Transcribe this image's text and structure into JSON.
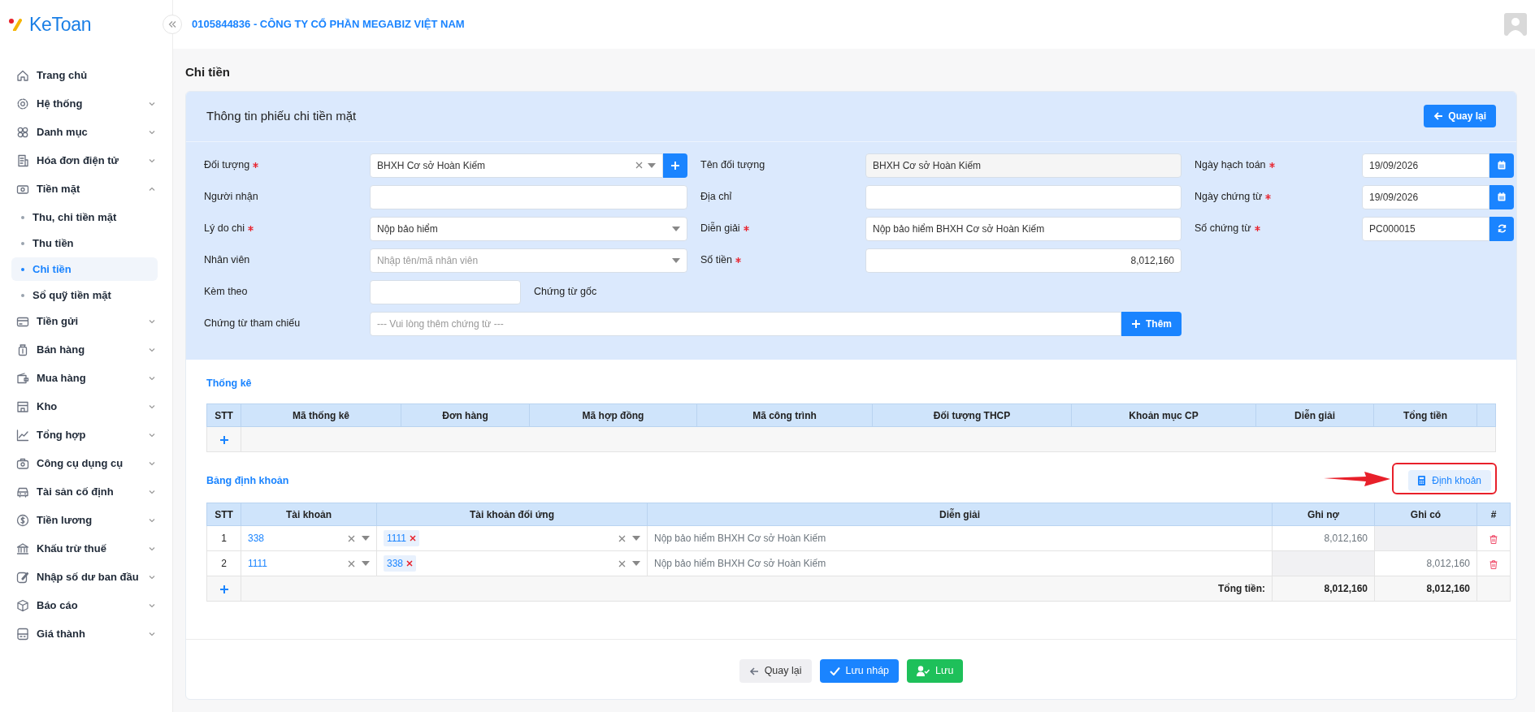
{
  "brand": {
    "name": "KeToan"
  },
  "header": {
    "company": "0105844836 - CÔNG TY CỔ PHẦN MEGABIZ VIỆT NAM"
  },
  "sidebar": {
    "items": [
      {
        "label": "Trang chủ",
        "kind": "link"
      },
      {
        "label": "Hệ thống",
        "kind": "group",
        "expanded": false
      },
      {
        "label": "Danh mục",
        "kind": "group",
        "expanded": false
      },
      {
        "label": "Hóa đơn điện tử",
        "kind": "group",
        "expanded": false
      },
      {
        "label": "Tiền mặt",
        "kind": "group",
        "expanded": true,
        "children": [
          {
            "label": "Thu, chi tiền mặt",
            "selected": false
          },
          {
            "label": "Thu tiền",
            "selected": false
          },
          {
            "label": "Chi tiền",
            "selected": true
          },
          {
            "label": "Sổ quỹ tiền mặt",
            "selected": false
          }
        ]
      },
      {
        "label": "Tiền gửi",
        "kind": "group",
        "expanded": false
      },
      {
        "label": "Bán hàng",
        "kind": "group",
        "expanded": false
      },
      {
        "label": "Mua hàng",
        "kind": "group",
        "expanded": false
      },
      {
        "label": "Kho",
        "kind": "group",
        "expanded": false
      },
      {
        "label": "Tổng hợp",
        "kind": "group",
        "expanded": false
      },
      {
        "label": "Công cụ dụng cụ",
        "kind": "group",
        "expanded": false
      },
      {
        "label": "Tài sản cố định",
        "kind": "group",
        "expanded": false
      },
      {
        "label": "Tiền lương",
        "kind": "group",
        "expanded": false
      },
      {
        "label": "Khấu trừ thuế",
        "kind": "group",
        "expanded": false
      },
      {
        "label": "Nhập số dư ban đầu",
        "kind": "group",
        "expanded": false
      },
      {
        "label": "Báo cáo",
        "kind": "group",
        "expanded": false
      },
      {
        "label": "Giá thành",
        "kind": "group",
        "expanded": false
      }
    ]
  },
  "page": {
    "title": "Chi tiền"
  },
  "form": {
    "title": "Thông tin phiếu chi tiền mặt",
    "back_button": "Quay lại",
    "rows": [
      [
        {
          "label": "Đối tượng",
          "required": true,
          "kind": "combo",
          "value": "BHXH Cơ sở Hoàn Kiếm"
        },
        {
          "label": "Tên đối tượng",
          "required": false,
          "kind": "readonly",
          "value": "BHXH Cơ sở Hoàn Kiếm"
        },
        {
          "label": "Ngày hạch toán",
          "required": true,
          "kind": "date",
          "value": "19/09/2026"
        }
      ],
      [
        {
          "label": "Người nhận",
          "required": false,
          "kind": "text"
        },
        {
          "label": "Địa chỉ",
          "required": false,
          "kind": "text"
        },
        {
          "label": "Ngày chứng từ",
          "required": true,
          "kind": "date",
          "value": "19/09/2026"
        }
      ],
      [
        {
          "label": "Lý do chi",
          "required": true,
          "kind": "select",
          "value": "Nộp bảo hiểm"
        },
        {
          "label": "Diễn giải",
          "required": true,
          "kind": "text",
          "value": "Nộp bảo hiểm BHXH Cơ sở Hoàn Kiếm"
        },
        {
          "label": "Số chứng từ",
          "required": true,
          "kind": "code",
          "value": "PC000015"
        }
      ],
      [
        {
          "label": "Nhân viên",
          "required": false,
          "kind": "select",
          "placeholder": "Nhập tên/mã nhân viên"
        },
        {
          "label": "Số tiền",
          "required": true,
          "kind": "amount",
          "value": "8,012,160"
        }
      ],
      [
        {
          "label": "Kèm theo",
          "required": false,
          "kind": "short",
          "note": "Chứng từ gốc"
        }
      ],
      [
        {
          "label": "Chứng từ tham chiếu",
          "required": false,
          "kind": "reference",
          "placeholder": "--- Vui lòng thêm chứng từ ---",
          "button": "Thêm"
        }
      ]
    ]
  },
  "statistics": {
    "title": "Thống kê",
    "columns": [
      "STT",
      "Mã thống kê",
      "Đơn hàng",
      "Mã hợp đồng",
      "Mã công trình",
      "Đối tượng THCP",
      "Khoản mục CP",
      "Diễn giải",
      "Tổng tiền"
    ]
  },
  "entries": {
    "title": "Bảng định khoản",
    "button": {
      "label": "Định khoản",
      "annotated": true
    },
    "columns": [
      "STT",
      "Tài khoản",
      "Tài khoản đối ứng",
      "Diễn giải",
      "Ghi nợ",
      "Ghi có",
      "#"
    ],
    "rows": [
      {
        "stt": "1",
        "account": "338",
        "contra": [
          "1111"
        ],
        "description": "Nộp bảo hiểm BHXH Cơ sở Hoàn Kiếm",
        "debit": "8,012,160"
      },
      {
        "stt": "2",
        "account": "1111",
        "contra": [
          "338"
        ],
        "description": "Nộp bảo hiểm BHXH Cơ sở Hoàn Kiếm",
        "credit": "8,012,160"
      }
    ],
    "total": {
      "label": "Tổng tiền:",
      "debit": "8,012,160",
      "credit": "8,012,160"
    }
  },
  "footer": {
    "buttons": [
      {
        "label": "Quay lại",
        "kind": "back"
      },
      {
        "label": "Lưu nháp",
        "kind": "draft"
      },
      {
        "label": "Lưu",
        "kind": "save"
      }
    ]
  }
}
